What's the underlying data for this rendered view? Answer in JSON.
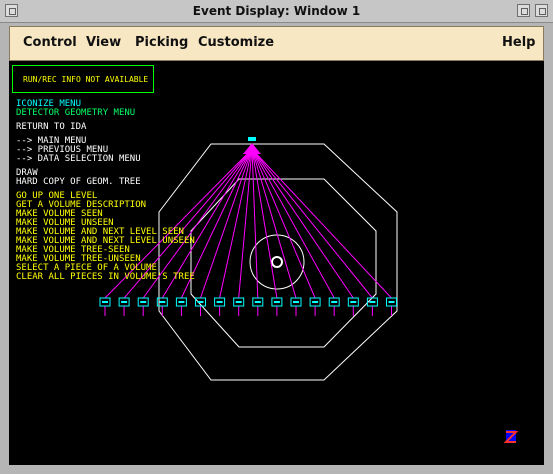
{
  "window": {
    "title": "Event Display:  Window 1"
  },
  "menubar": {
    "items": [
      "Control",
      "View",
      "Picking",
      "Customize"
    ],
    "help": "Help"
  },
  "display": {
    "info_box": "RUN/REC INFO NOT AVAILABLE",
    "menu_iconize": "ICONIZE MENU",
    "menu_detector": "DETECTOR GEOMETRY MENU",
    "return": "RETURN TO IDA",
    "nav": [
      "--> MAIN MENU",
      "--> PREVIOUS MENU",
      "--> DATA SELECTION MENU"
    ],
    "draw": [
      "DRAW",
      "HARD COPY OF GEOM. TREE"
    ],
    "commands": [
      "GO UP ONE LEVEL",
      "GET A VOLUME DESCRIPTION",
      "MAKE VOLUME SEEN",
      "MAKE VOLUME UNSEEN",
      "MAKE VOLUME AND NEXT LEVEL SEEN",
      "MAKE VOLUME AND NEXT LEVEL UNSEEN",
      "MAKE VOLUME TREE-SEEN",
      "MAKE VOLUME TREE-UNSEEN",
      "SELECT A PIECE OF A VOLUME",
      "CLEAR ALL PIECES IN VOLUME'S TREE"
    ],
    "root_label": "ALC",
    "child_count": 16,
    "colors": {
      "yellow": "#ffff00",
      "cyan": "#00ffff",
      "green": "#00ff66",
      "magenta": "#ff00ff",
      "white": "#ffffff"
    }
  }
}
